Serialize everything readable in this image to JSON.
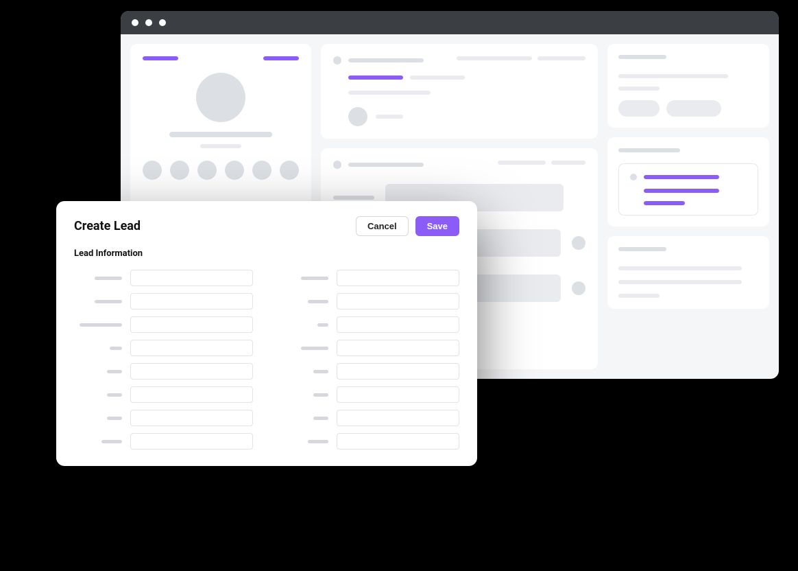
{
  "modal": {
    "title": "Create Lead",
    "cancel_label": "Cancel",
    "save_label": "Save",
    "section_label": "Lead Information",
    "left_fields_count": 8,
    "right_fields_count": 8
  }
}
